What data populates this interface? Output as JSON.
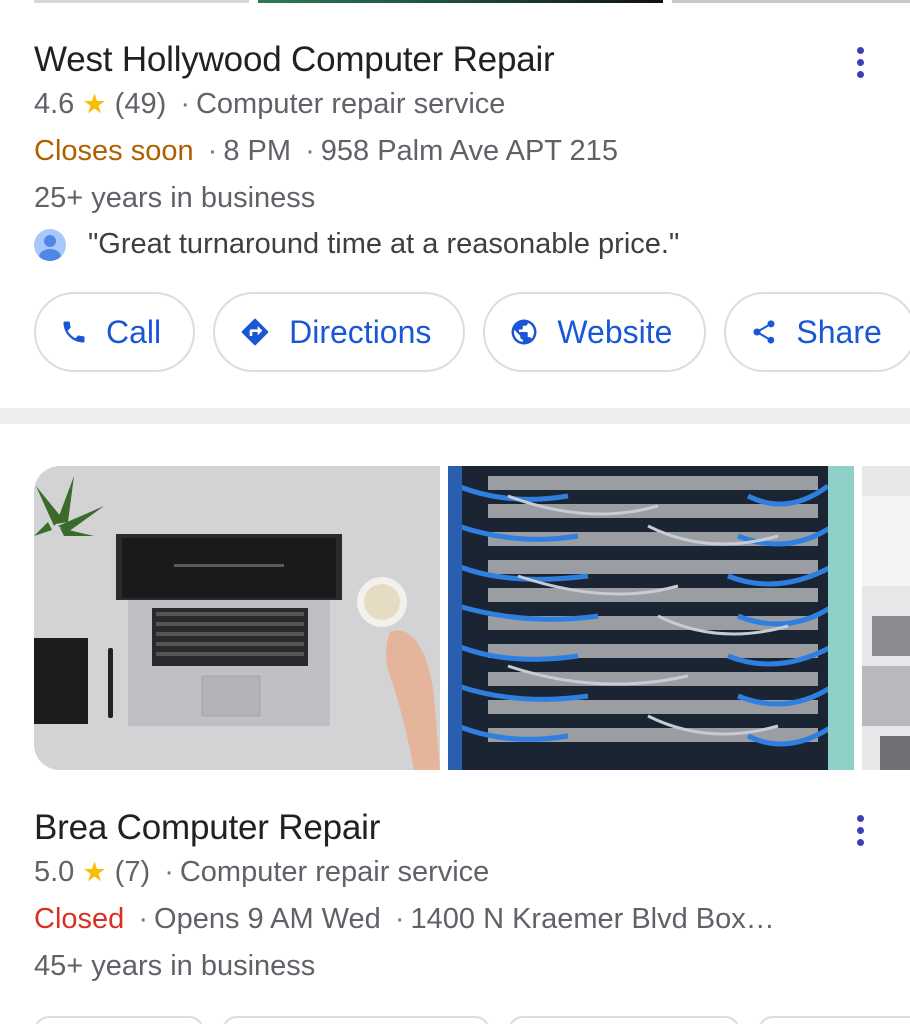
{
  "listing1": {
    "name": "West Hollywood Computer Repair",
    "rating": "4.6",
    "reviews": "(49)",
    "category": "Computer repair service",
    "status": "Closes soon",
    "hours": "8 PM",
    "address": "958 Palm Ave APT 215",
    "years": "25+ years in business",
    "review_quote": "\"Great turnaround time at a reasonable price.\"",
    "actions": {
      "call": "Call",
      "directions": "Directions",
      "website": "Website",
      "share": "Share"
    }
  },
  "listing2": {
    "name": "Brea Computer Repair",
    "rating": "5.0",
    "reviews": "(7)",
    "category": "Computer repair service",
    "status": "Closed",
    "hours": "Opens 9 AM Wed",
    "address": "1400 N Kraemer Blvd Box…",
    "years": "45+ years in business"
  },
  "icons": {
    "star": "★",
    "separator": "·"
  },
  "colors": {
    "accent_blue": "#1a57d6",
    "closes_soon": "#b06000",
    "closed": "#d93025",
    "star": "#fbbc04"
  }
}
